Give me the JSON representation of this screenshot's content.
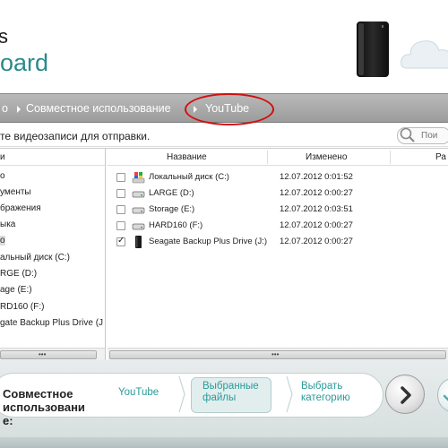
{
  "header": {
    "brand_partial": "s",
    "brand": "oard",
    "accent": "#2a8a8a"
  },
  "breadcrumb": {
    "items": [
      "о",
      "Совместное использование",
      "YouTube"
    ]
  },
  "instruction": {
    "text": "те видеозаписи для отправки.",
    "search_placeholder": "Пои"
  },
  "left_tree": {
    "header": "и",
    "items": [
      {
        "label": "о"
      },
      {
        "label": "ументы"
      },
      {
        "label": "бражения"
      },
      {
        "label": "ыка"
      },
      {
        "label": "о"
      },
      {
        "label": "альный диск (C:)"
      },
      {
        "label": "RGE (D:)"
      },
      {
        "label": "age (E:)"
      },
      {
        "label": "RD160 (F:)"
      },
      {
        "label": "gate Backup Plus Drive (J"
      }
    ],
    "scroll_grip": "•••"
  },
  "file_list": {
    "columns": [
      "Название",
      "Изменено",
      "Ра"
    ],
    "rows": [
      {
        "name": "Локальный диск (C:)",
        "modified": "12.07.2012 0:01:52",
        "checked": false,
        "icon": "system-drive-icon"
      },
      {
        "name": "LARGE (D:)",
        "modified": "12.07.2012 0:00:27",
        "checked": false,
        "icon": "hard-drive-icon"
      },
      {
        "name": "Storage (E:)",
        "modified": "12.07.2012 0:03:51",
        "checked": false,
        "icon": "hard-drive-icon"
      },
      {
        "name": "HARD160 (F:)",
        "modified": "12.07.2012 0:00:27",
        "checked": false,
        "icon": "hard-drive-icon"
      },
      {
        "name": "Seagate Backup Plus Drive (J:)",
        "modified": "12.07.2012 0:00:27",
        "checked": true,
        "icon": "external-drive-icon"
      }
    ],
    "scroll_grip": "•••"
  },
  "footer": {
    "step_label": "Совместное\nиспользовани\nе:",
    "steps": [
      "YouTube",
      "Выбранные\nфайлы",
      "Выбрать\nкатегорию"
    ]
  }
}
